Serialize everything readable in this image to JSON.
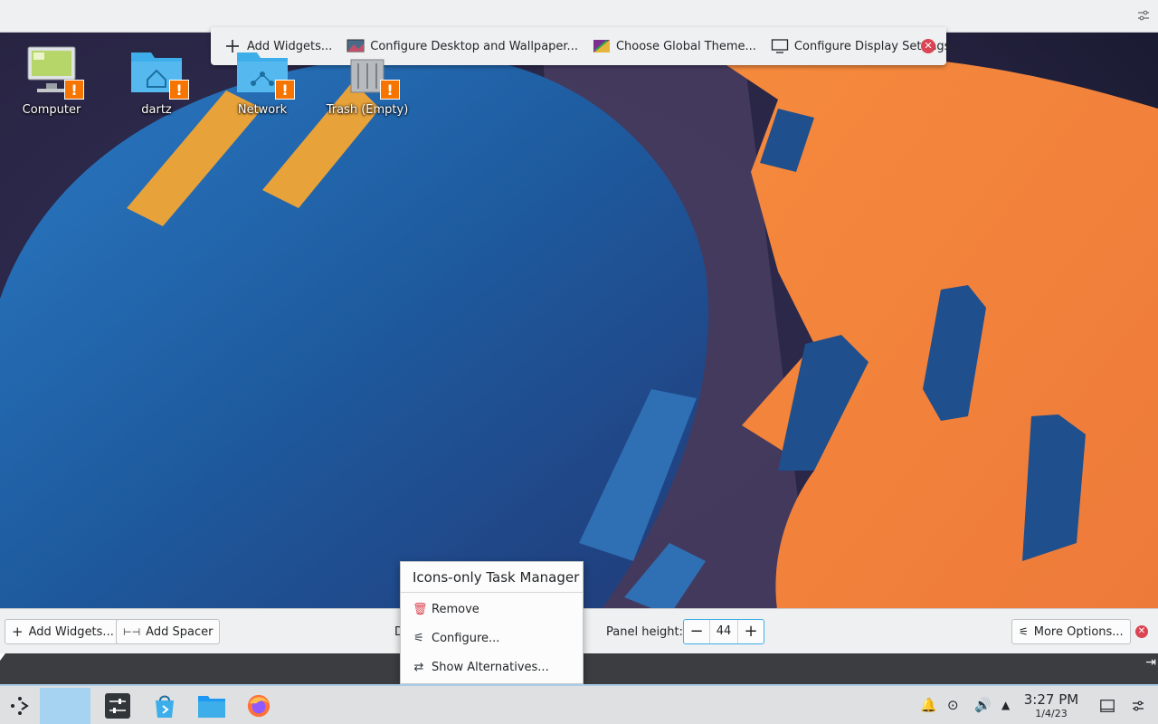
{
  "desktop_toolbar": {
    "add_widgets": "Add Widgets...",
    "configure_desktop": "Configure Desktop and Wallpaper...",
    "global_theme": "Choose Global Theme...",
    "display_settings": "Configure Display Settings..."
  },
  "desktop_icons": [
    {
      "name": "Computer"
    },
    {
      "name": "dartz"
    },
    {
      "name": "Network"
    },
    {
      "name": "Trash (Empty)"
    }
  ],
  "panel_toolbar": {
    "add_widgets": "Add Widgets...",
    "add_spacer": "Add Spacer",
    "drag_label": "D",
    "panel_height_label": "Panel height:",
    "panel_height_value": "44",
    "more_options": "More Options..."
  },
  "context_menu": {
    "title": "Icons-only Task Manager",
    "items": [
      {
        "label": "Remove",
        "icon": "trash-icon"
      },
      {
        "label": "Configure...",
        "icon": "configure-icon"
      },
      {
        "label": "Show Alternatives...",
        "icon": "alternatives-icon"
      }
    ]
  },
  "taskbar": {
    "clock_time": "3:27 PM",
    "clock_date": "1/4/23",
    "tray_icons": [
      "notifications-icon",
      "updates-icon",
      "volume-icon",
      "expand-tray-icon"
    ]
  },
  "colors": {
    "accent": "#3daee9",
    "close_red": "#da4453",
    "warning_orange": "#f67400",
    "task_highlight": "#a6d3f2"
  }
}
